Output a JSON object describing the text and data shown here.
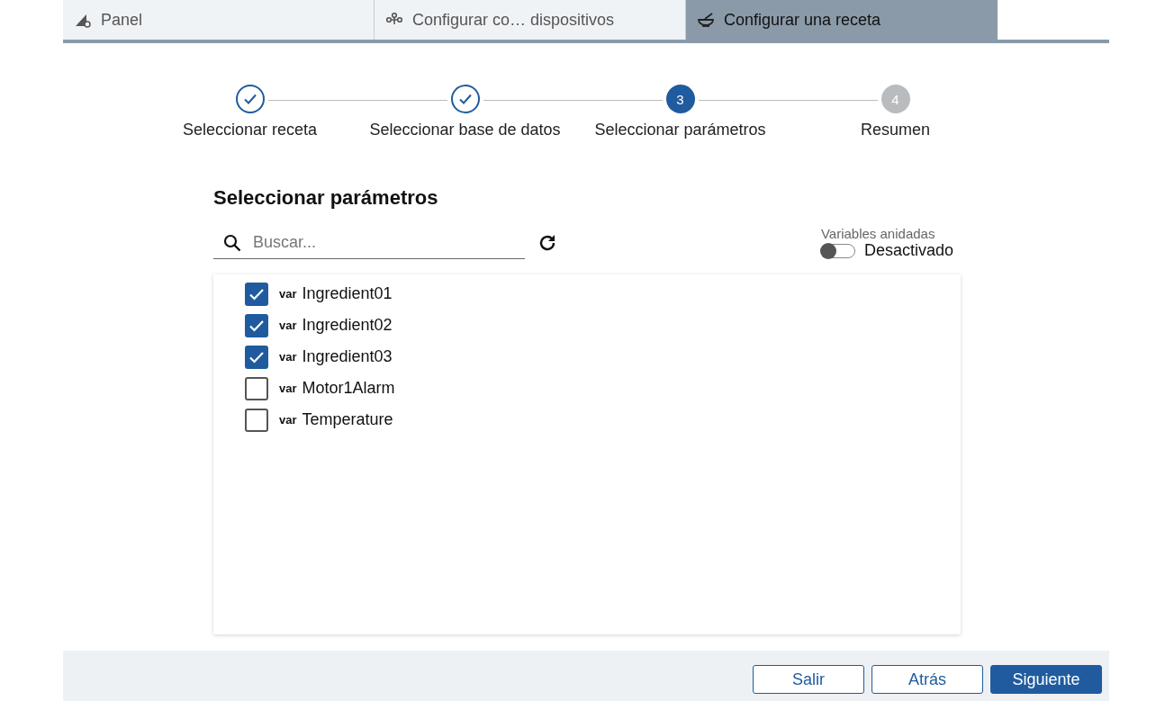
{
  "tabs": [
    {
      "label": "Panel",
      "selected": false
    },
    {
      "label": "Configurar co… dispositivos",
      "selected": false
    },
    {
      "label": "Configurar una receta",
      "selected": true
    }
  ],
  "stepper": [
    {
      "label": "Seleccionar receta",
      "kind": "done"
    },
    {
      "label": "Seleccionar base de datos",
      "kind": "done"
    },
    {
      "number": "3",
      "label": "Seleccionar parámetros",
      "kind": "current"
    },
    {
      "number": "4",
      "label": "Resumen",
      "kind": "pending"
    }
  ],
  "heading": "Seleccionar parámetros",
  "search": {
    "placeholder": "Buscar..."
  },
  "nested_toggle": {
    "caption": "Variables anidadas",
    "label": "Desactivado",
    "on": false
  },
  "variables": [
    {
      "tag": "var",
      "name": "Ingredient01",
      "checked": true
    },
    {
      "tag": "var",
      "name": "Ingredient02",
      "checked": true
    },
    {
      "tag": "var",
      "name": "Ingredient03",
      "checked": true
    },
    {
      "tag": "var",
      "name": "Motor1Alarm",
      "checked": false
    },
    {
      "tag": "var",
      "name": "Temperature",
      "checked": false
    }
  ],
  "buttons": [
    {
      "label": "Salir",
      "kind": "secondary"
    },
    {
      "label": "Atrás",
      "kind": "secondary"
    },
    {
      "label": "Siguiente",
      "kind": "primary"
    }
  ]
}
